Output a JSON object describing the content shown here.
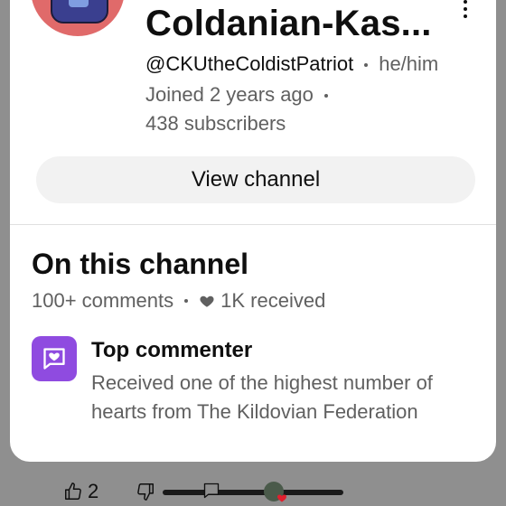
{
  "channel": {
    "name": "Coldanian-Kas...",
    "handle": "@CKUtheColdistPatriot",
    "pronouns": "he/him",
    "joined": "Joined 2 years ago",
    "subscribers": "438 subscribers",
    "view_channel_label": "View channel"
  },
  "on_channel": {
    "title": "On this channel",
    "comments": "100+ comments",
    "hearts": "1K received",
    "badge": {
      "title": "Top commenter",
      "description": "Received one of the highest number of hearts from The Kildovian Federation",
      "color": "#8f4be0"
    }
  },
  "bottom": {
    "like_count": "2"
  },
  "icons": [
    "more-vert-icon",
    "heart-icon",
    "heart-badge-icon",
    "thumb-up-icon",
    "thumb-down-icon",
    "comment-icon"
  ]
}
